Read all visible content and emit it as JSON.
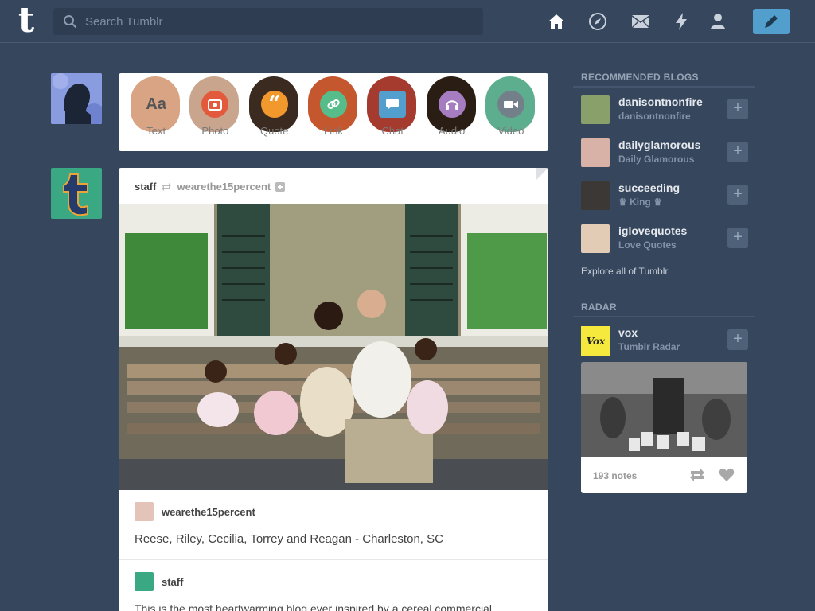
{
  "header": {
    "logo_letter": "t",
    "search": {
      "placeholder": "Search Tumblr"
    },
    "nav": [
      "home-icon",
      "compass-icon",
      "inbox-icon",
      "activity-icon",
      "account-icon"
    ],
    "compose_icon": "pencil-icon"
  },
  "post_types": [
    {
      "label": "Text",
      "icon": "Aa",
      "color": "#444444"
    },
    {
      "label": "Photo",
      "icon": "photo-icon",
      "color": "#d95e40"
    },
    {
      "label": "Quote",
      "icon": "quote-icon",
      "color": "#f2992e"
    },
    {
      "label": "Link",
      "icon": "link-icon",
      "color": "#56bc8a"
    },
    {
      "label": "Chat",
      "icon": "chat-icon",
      "color": "#529ecc"
    },
    {
      "label": "Audio",
      "icon": "audio-icon",
      "color": "#a77dc2"
    },
    {
      "label": "Video",
      "icon": "video-icon",
      "color": "#748089"
    }
  ],
  "post": {
    "author": "staff",
    "reblogged_from": "wearethe15percent",
    "source_name": "wearethe15percent",
    "caption": "Reese, Riley, Cecilia, Torrey and Reagan - Charleston, SC",
    "commenter": "staff",
    "comment": "This is the most heartwarming blog ever inspired by a cereal commercial."
  },
  "sidebar": {
    "recommended_title": "RECOMMENDED BLOGS",
    "blogs": [
      {
        "name": "danisontnonfire",
        "title": "danisontnonfire"
      },
      {
        "name": "dailyglamorous",
        "title": "Daily Glamorous"
      },
      {
        "name": "succeeding",
        "title": "♛ King ♛"
      },
      {
        "name": "iglovequotes",
        "title": "Love Quotes"
      }
    ],
    "explore": "Explore all of Tumblr",
    "radar_title": "RADAR",
    "radar": {
      "name": "vox",
      "title": "Tumblr Radar",
      "logo_text": "Vox",
      "notes": "193 notes"
    }
  },
  "colors": {
    "background": "#36465d",
    "accent": "#529ecc",
    "vox": "#f6e93e"
  }
}
